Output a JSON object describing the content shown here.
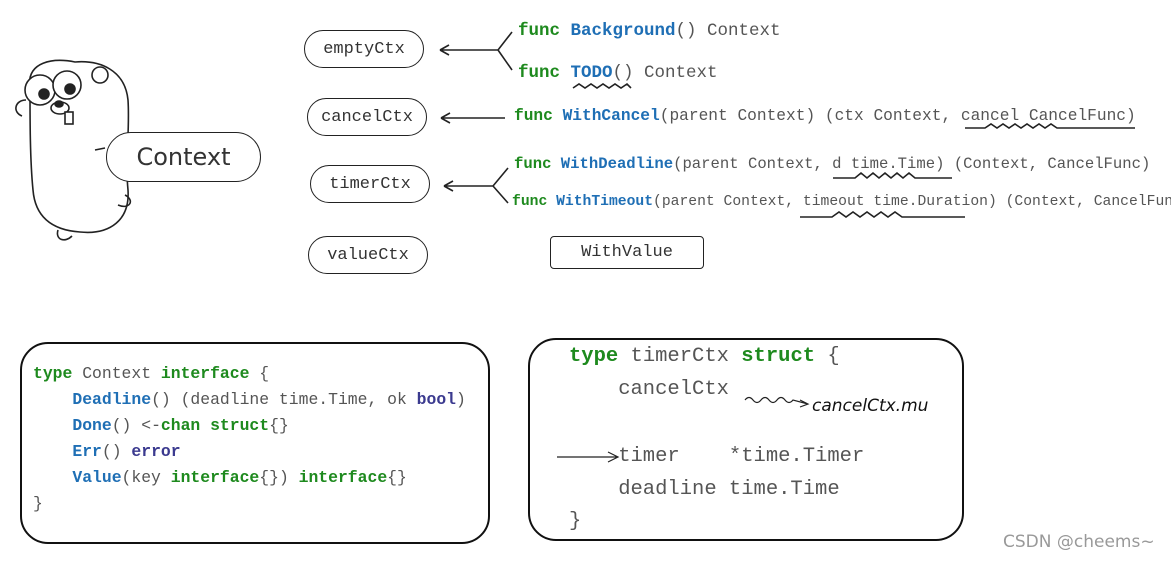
{
  "mascot": {
    "label": "Context"
  },
  "structs": [
    "emptyCtx",
    "cancelCtx",
    "timerCtx",
    "valueCtx"
  ],
  "funcs": [
    [
      {
        "t": "func ",
        "c": "kw"
      },
      {
        "t": "Background",
        "c": "fn"
      },
      {
        "t": "() Context",
        "c": "pl"
      }
    ],
    [
      {
        "t": "func ",
        "c": "kw"
      },
      {
        "t": "TODO",
        "c": "fn"
      },
      {
        "t": "() Context",
        "c": "pl"
      }
    ],
    [
      {
        "t": "func ",
        "c": "kw"
      },
      {
        "t": "WithCancel",
        "c": "fn"
      },
      {
        "t": "(parent Context) (ctx Context, cancel CancelFunc)",
        "c": "pl"
      }
    ],
    [
      {
        "t": "func ",
        "c": "kw"
      },
      {
        "t": "WithDeadline",
        "c": "fn"
      },
      {
        "t": "(parent Context, d time.Time) (Context, CancelFunc)",
        "c": "pl"
      }
    ],
    [
      {
        "t": "func ",
        "c": "kw"
      },
      {
        "t": "WithTimeout",
        "c": "fn"
      },
      {
        "t": "(parent Context, timeout time.Duration) (Context, CancelFunc)",
        "c": "pl"
      }
    ]
  ],
  "with_value": "WithValue",
  "interface_code": [
    [
      {
        "t": "type ",
        "c": "kw"
      },
      {
        "t": "Context ",
        "c": "pl"
      },
      {
        "t": "interface",
        "c": "kw"
      },
      {
        "t": " {",
        "c": "pl"
      }
    ],
    [
      {
        "t": "    ",
        "c": "pl"
      },
      {
        "t": "Deadline",
        "c": "fn"
      },
      {
        "t": "() (deadline time.Time, ok ",
        "c": "pl"
      },
      {
        "t": "bool",
        "c": "ty"
      },
      {
        "t": ")",
        "c": "pl"
      }
    ],
    [
      {
        "t": "    ",
        "c": "pl"
      },
      {
        "t": "Done",
        "c": "fn"
      },
      {
        "t": "() <-",
        "c": "pl"
      },
      {
        "t": "chan struct",
        "c": "kw"
      },
      {
        "t": "{}",
        "c": "pl"
      }
    ],
    [
      {
        "t": "    ",
        "c": "pl"
      },
      {
        "t": "Err",
        "c": "fn"
      },
      {
        "t": "() ",
        "c": "pl"
      },
      {
        "t": "error",
        "c": "ty"
      }
    ],
    [
      {
        "t": "    ",
        "c": "pl"
      },
      {
        "t": "Value",
        "c": "fn"
      },
      {
        "t": "(key ",
        "c": "pl"
      },
      {
        "t": "interface",
        "c": "kw"
      },
      {
        "t": "{}) ",
        "c": "pl"
      },
      {
        "t": "interface",
        "c": "kw"
      },
      {
        "t": "{}",
        "c": "pl"
      }
    ],
    [
      {
        "t": "}",
        "c": "pl"
      }
    ]
  ],
  "timer_struct": [
    [
      {
        "t": "type ",
        "c": "kw"
      },
      {
        "t": "timerCtx ",
        "c": "pl"
      },
      {
        "t": "struct",
        "c": "kw"
      },
      {
        "t": " {",
        "c": "pl"
      }
    ],
    [
      {
        "t": "    cancelCtx",
        "c": "pl"
      }
    ],
    [
      {
        "t": "    timer    *time.Timer",
        "c": "pl"
      }
    ],
    [
      {
        "t": "    deadline time.Time",
        "c": "pl"
      }
    ],
    [
      {
        "t": "}",
        "c": "pl"
      }
    ]
  ],
  "annotation": "cancelCtx.mu",
  "watermark": "CSDN @cheems~"
}
